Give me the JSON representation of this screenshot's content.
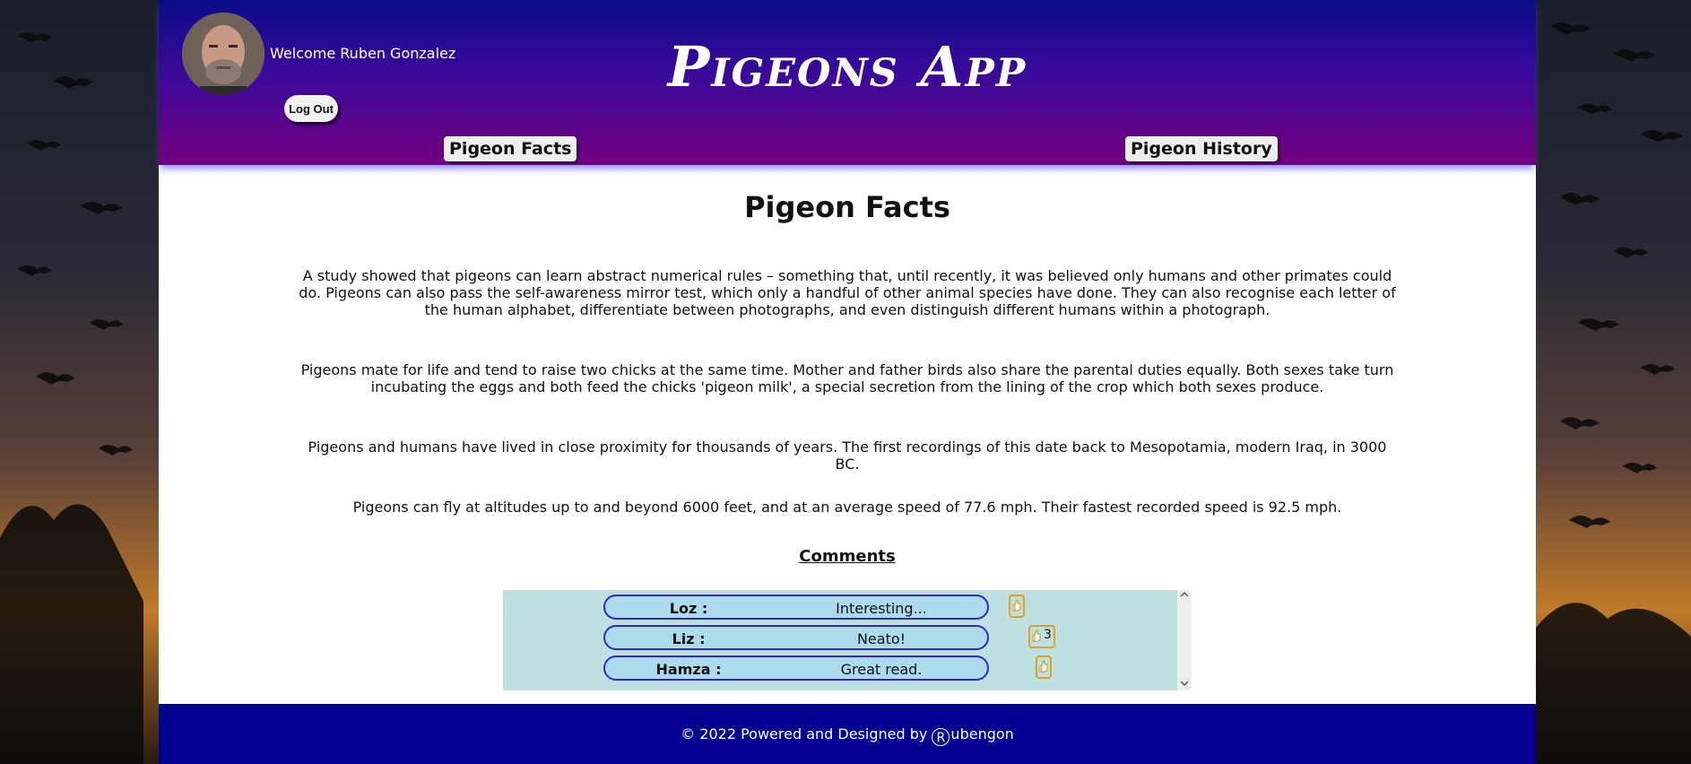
{
  "header": {
    "welcome": "Welcome Ruben Gonzalez",
    "logout_label": "Log Out",
    "app_title": "Pigeons App"
  },
  "nav": {
    "facts_label": "Pigeon Facts",
    "history_label": "Pigeon History"
  },
  "main": {
    "title": "Pigeon Facts",
    "facts": [
      "A study showed that pigeons can learn abstract numerical rules – something that, until recently, it was believed only humans and other primates could do. Pigeons can also pass the self-awareness mirror test, which only a handful of other animal species have done. They can also recognise each letter of the human alphabet, differentiate between photographs, and even distinguish different humans within a photograph.",
      "Pigeons mate for life and tend to raise two chicks at the same time. Mother and father birds also share the parental duties equally. Both sexes take turn incubating the eggs and both feed the chicks 'pigeon milk', a special secretion from the lining of the crop which both sexes produce.",
      "Pigeons and humans have lived in close proximity for thousands of years. The first recordings of this date back to Mesopotamia, modern Iraq, in 3000 BC.",
      "Pigeons can fly at altitudes up to and beyond 6000 feet, and at an average speed of 77.6 mph. Their fastest recorded speed is 92.5 mph."
    ],
    "comments_heading": "Comments",
    "comments": [
      {
        "name": "Loz :",
        "text": "Interesting...",
        "likes": ""
      },
      {
        "name": "Liz :",
        "text": "Neato!",
        "likes": "3"
      },
      {
        "name": "Hamza :",
        "text": "Great read.",
        "likes": ""
      }
    ]
  },
  "footer": {
    "text_before": "© 2022 Powered and Designed by",
    "reg_symbol": "R",
    "text_after": "ubengon"
  },
  "icons": {
    "like": "thumbs-up-icon",
    "scroll_up": "chevron-up-icon",
    "scroll_down": "chevron-down-icon"
  },
  "colors": {
    "header_top": "#0c0a8a",
    "header_bottom": "#74007f",
    "footer": "#03008f",
    "comment_box": "#bfe0e0",
    "comment_row": "#acdcec",
    "comment_border": "#2a2ad0",
    "like_border": "#e0a020"
  }
}
